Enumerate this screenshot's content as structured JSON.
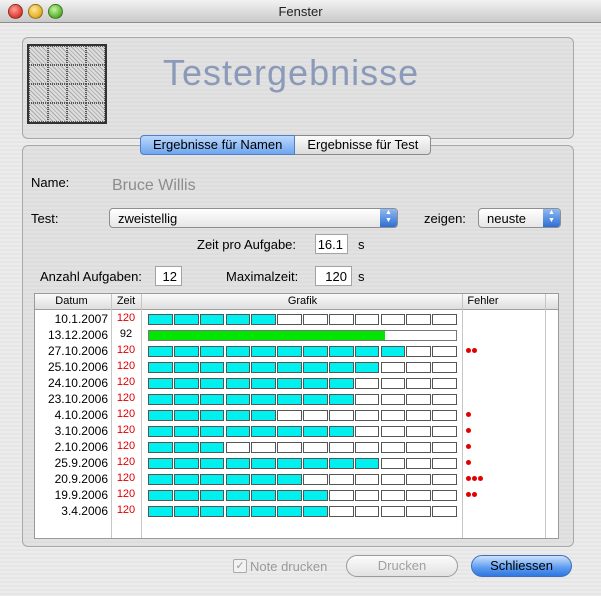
{
  "window": {
    "title": "Fenster"
  },
  "header": {
    "title": "Testergebnisse"
  },
  "tabs": [
    {
      "label": "Ergebnisse für Namen",
      "active": true
    },
    {
      "label": "Ergebnisse für Test",
      "active": false
    }
  ],
  "form": {
    "name_label": "Name:",
    "name_value": "Bruce Willis",
    "test_label": "Test:",
    "test_value": "zweistellig",
    "show_label": "zeigen:",
    "show_value": "neuste",
    "time_per_task_label": "Zeit pro Aufgabe:",
    "time_per_task_value": "16.1",
    "time_per_task_unit": "s",
    "task_count_label": "Anzahl Aufgaben:",
    "task_count_value": "12",
    "max_time_label": "Maximalzeit:",
    "max_time_value": "120",
    "max_time_unit": "s"
  },
  "table": {
    "columns": [
      "Datum",
      "Zeit",
      "Grafik",
      "Fehler"
    ],
    "rows": [
      {
        "date": "10.1.2007",
        "time": "120",
        "filled": 5,
        "errors": 0,
        "bar": "segments"
      },
      {
        "date": "13.12.2006",
        "time": "92",
        "fraction": 0.77,
        "errors": 0,
        "bar": "solid"
      },
      {
        "date": "27.10.2006",
        "time": "120",
        "filled": 10,
        "errors": 2,
        "bar": "segments"
      },
      {
        "date": "25.10.2006",
        "time": "120",
        "filled": 9,
        "errors": 0,
        "bar": "segments"
      },
      {
        "date": "24.10.2006",
        "time": "120",
        "filled": 8,
        "errors": 0,
        "bar": "segments"
      },
      {
        "date": "23.10.2006",
        "time": "120",
        "filled": 8,
        "errors": 0,
        "bar": "segments"
      },
      {
        "date": "4.10.2006",
        "time": "120",
        "filled": 5,
        "errors": 1,
        "bar": "segments"
      },
      {
        "date": "3.10.2006",
        "time": "120",
        "filled": 8,
        "errors": 1,
        "bar": "segments"
      },
      {
        "date": "2.10.2006",
        "time": "120",
        "filled": 3,
        "errors": 1,
        "bar": "segments"
      },
      {
        "date": "25.9.2006",
        "time": "120",
        "filled": 9,
        "errors": 1,
        "bar": "segments"
      },
      {
        "date": "20.9.2006",
        "time": "120",
        "filled": 6,
        "errors": 3,
        "bar": "segments"
      },
      {
        "date": "19.9.2006",
        "time": "120",
        "filled": 7,
        "errors": 2,
        "bar": "segments"
      },
      {
        "date": "3.4.2006",
        "time": "120",
        "filled": 7,
        "errors": 0,
        "bar": "segments"
      }
    ],
    "segments_per_row": 12
  },
  "footer": {
    "print_note_label": "Note drucken",
    "print_button": "Drucken",
    "close_button": "Schliessen"
  },
  "colors": {
    "segment_fill": "#00f0f0",
    "solid_fill": "#00e600",
    "error_dot": "#e00000",
    "slow_time": "#d00000",
    "accent": "#3b7fe0"
  },
  "icons": {
    "logo": "puzzle-grid-logo",
    "popup_arrows": "up-down-arrows-icon",
    "checkbox": "checkmark-icon"
  }
}
